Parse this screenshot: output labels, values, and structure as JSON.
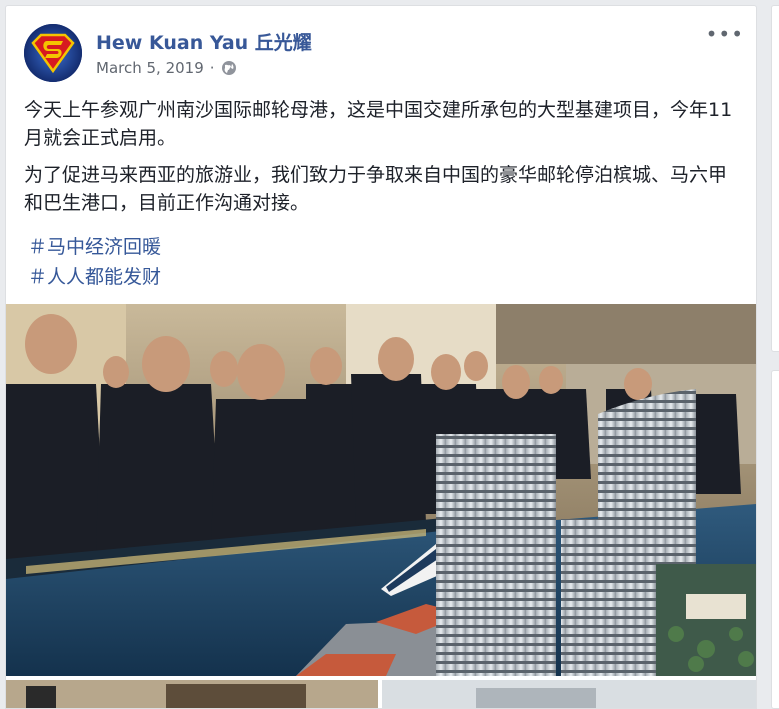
{
  "post": {
    "author": "Hew Kuan Yau 丘光耀",
    "date": "March 5, 2019",
    "date_separator": "·",
    "privacy_icon": "globe-icon",
    "more_icon": "more-options-icon",
    "more_label": "•••",
    "paragraphs": [
      "今天上午参观广州南沙国际邮轮母港，这是中国交建所承包的大型基建项目，今年11月就会正式启用。",
      "为了促进马来西亚的旅游业，我们致力于争取来自中国的豪华邮轮停泊槟城、马六甲和巴生港口，目前正作沟通对接。"
    ],
    "hashtags": [
      "＃马中经济回暖",
      "＃人人都能发财"
    ]
  },
  "colors": {
    "author_link": "#385898",
    "hashtag_link": "#365899",
    "text": "#1d2129",
    "meta": "#616770",
    "background": "#e9ebee"
  }
}
